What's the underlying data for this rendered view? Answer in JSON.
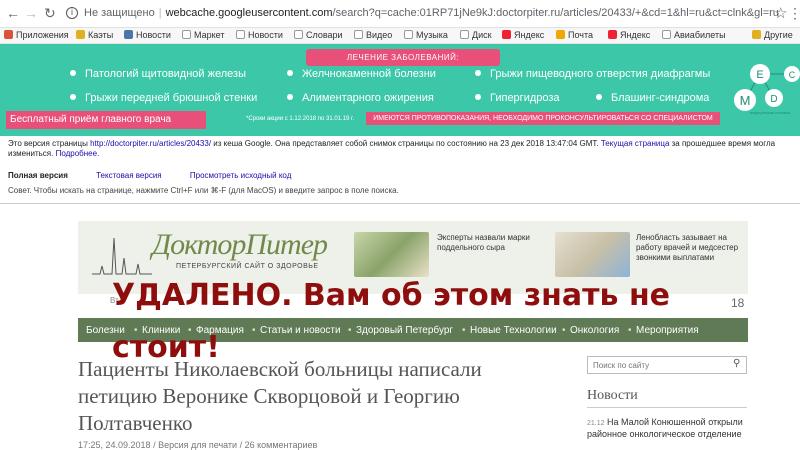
{
  "browser": {
    "security": "Не защищено",
    "host": "webcache.googleusercontent.com",
    "path": "/search?q=cache:01RP71jNe9kJ:doctorpiter.ru/articles/20433/+&cd=1&hl=ru&ct=clnk&gl=ru",
    "bookmarks": [
      "Приложения",
      "Каэты",
      "Новости",
      "Маркет",
      "Новости",
      "Словари",
      "Видео",
      "Музыка",
      "Диск",
      "Яндекс",
      "Почта",
      "Яндекс",
      "Авиабилеты",
      "Другие"
    ]
  },
  "banner": {
    "heading": "ЛЕЧЕНИЕ ЗАБОЛЕВАНИЙ:",
    "items": [
      "Патологий щитовидной железы",
      "Желчнокаменной болезни",
      "Грыжи пищеводного отверстия диафрагмы",
      "Грыжи передней брюшной стенки",
      "Алиментарного ожирения",
      "Гипергидроза",
      "Блашинг-синдрома"
    ],
    "cta": "Бесплатный приём главного врача",
    "note_small": "*Сроки акции с 1.12.2018 по 31.01.19 г.",
    "warning": "ИМЕЮТСЯ ПРОТИВОПОКАЗАНИЯ, НЕОБХОДИМО ПРОКОНСУЛЬТИРОВАТЬСЯ СО СПЕЦИАЛИСТОМ",
    "logo_letters": [
      "M",
      "E",
      "D",
      "C"
    ],
    "logo_caption": "медицинская клиника"
  },
  "cache": {
    "prefix": "Это версия страницы",
    "page_url": "http://doctorpiter.ru/articles/20433/",
    "middle": "из кеша Google. Она представляет собой снимок страницы по состоянию на 23 дек 2018 13:47:04 GMT.",
    "current_link": "Текущая страница",
    "suffix": "за прошедшее время могла измениться.",
    "more_link": "Подробнее.",
    "full": "Полная версия",
    "text": "Текстовая версия",
    "source": "Просмотреть исходный код",
    "hint": "Совет. Чтобы искать на странице, нажмите Ctrl+F или ⌘-F (для MacOS) и введите запрос в поле поиска."
  },
  "site": {
    "logo": "ДокторПитер",
    "logo_sub": "ПЕТЕРБУРГСКИЙ САЙТ О ЗДОРОВЬЕ",
    "promo1": "Эксперты назвали марки поддельного сыра",
    "promo2": "Ленобласть зазывает на работу врачей и медсестер звонкими выплатами",
    "date_left": "Вт",
    "date_right": "18",
    "nav": [
      "Болезни",
      "Клиники",
      "Фармация",
      "Статьи и новости",
      "Здоровый Петербург",
      "Новые Технологии",
      "Онкология",
      "Мероприятия"
    ]
  },
  "article": {
    "title": "Пациенты Николаевской больницы написали петицию Веронике Скворцовой и Георгию Полтавченко",
    "meta": "17:25, 24.09.2018 / Версия для печати / 26 комментариев"
  },
  "sidebar": {
    "search_placeholder": "Поиск по сайту",
    "heading": "Новости",
    "news_time": "21.12",
    "news_text": "На Малой Конюшенной открыли районное онкологическое отделение"
  },
  "overlay": {
    "line1": "УДАЛЕНО. Вам об этом знать не",
    "line2": "стоит!"
  },
  "colors": {
    "banner": "#3cc8a8",
    "accent_pink": "#e8507a",
    "site_green": "#5f7a55",
    "stamp_red": "#8e0e0e"
  }
}
